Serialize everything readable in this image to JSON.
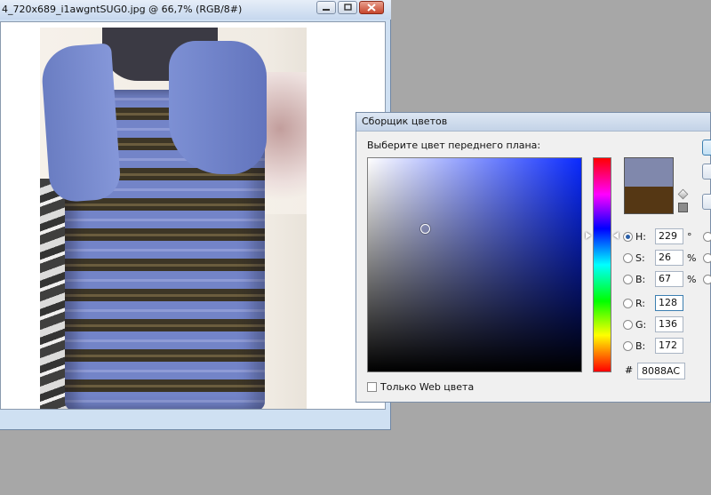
{
  "document_window": {
    "title": "4_720x689_i1awgntSUG0.jpg @ 66,7% (RGB/8#)",
    "buttons": [
      "minimize-icon",
      "restore-icon",
      "close-icon"
    ]
  },
  "color_picker": {
    "title": "Сборщик цветов",
    "prompt": "Выберите цвет переднего плана:",
    "colors": {
      "new": "#8088AC",
      "old": "#553714"
    },
    "hsb": {
      "h": {
        "label": "H:",
        "value": "229",
        "unit": "°",
        "selected": true
      },
      "s": {
        "label": "S:",
        "value": "26",
        "unit": "%"
      },
      "b": {
        "label": "B:",
        "value": "67",
        "unit": "%"
      }
    },
    "rgb": {
      "r": {
        "label": "R:",
        "value": "128"
      },
      "g": {
        "label": "G:",
        "value": "136"
      },
      "b": {
        "label": "B:",
        "value": "172"
      }
    },
    "hex_prefix": "#",
    "hex": "8088AC",
    "web_only_label": "Только Web цвета",
    "web_only_checked": false
  }
}
